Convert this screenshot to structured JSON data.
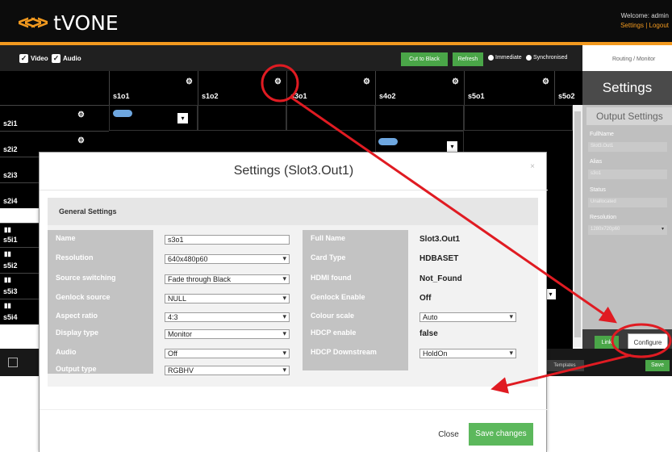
{
  "app": {
    "logo_text": "tVONE",
    "logo_mark": "<<>>"
  },
  "header": {
    "welcome": "Welcome: admin",
    "links": "Settings | Logout"
  },
  "toolbar": {
    "video_label": "Video",
    "audio_label": "Audio",
    "check_glyph": "✓",
    "cut_label": "Cut to Black",
    "refresh_label": "Refresh",
    "immediate_label": "Immediate",
    "synchronised_label": "Synchronised",
    "routing_label": "Routing / Monitor"
  },
  "grid": {
    "columns": [
      "s1o1",
      "s1o2",
      "s3o1",
      "s4o2",
      "s5o1",
      "s5o2"
    ],
    "rows": [
      "s2i1",
      "s2i2",
      "s2i3",
      "s2i4",
      "s5i1",
      "s5i2",
      "s5i3",
      "s5i4"
    ],
    "gear_glyph": "⚙",
    "dropdown_glyph": "▾"
  },
  "side_panel": {
    "title": "Settings",
    "subtitle": "Output Settings",
    "fields": [
      {
        "label": "FullName",
        "value": "Slot3.Out1"
      },
      {
        "label": "Alias",
        "value": "s3o1"
      },
      {
        "label": "Status",
        "value": "Unallocated"
      },
      {
        "label": "Resolution",
        "value": "1280x720p60"
      }
    ],
    "link_button": "Link",
    "configure_button": "Configure"
  },
  "bottom": {
    "templates_label": "Templates",
    "save_label": "Save"
  },
  "modal": {
    "title": "Settings (Slot3.Out1)",
    "close_x": "×",
    "section_title": "General Settings",
    "left_fields": [
      {
        "label": "Name",
        "value": "s3o1",
        "type": "text"
      },
      {
        "label": "Resolution",
        "value": "640x480p60",
        "type": "select"
      },
      {
        "label": "Source switching",
        "value": "Fade through Black",
        "type": "select"
      },
      {
        "label": "Genlock source",
        "value": "NULL",
        "type": "select"
      },
      {
        "label": "Aspect ratio",
        "value": "4:3",
        "type": "select"
      },
      {
        "label": "Display type",
        "value": "Monitor",
        "type": "select"
      },
      {
        "label": "Audio",
        "value": "Off",
        "type": "select"
      },
      {
        "label": "Output type",
        "value": "RGBHV",
        "type": "select"
      }
    ],
    "right_fields": [
      {
        "label": "Full Name",
        "value": "Slot3.Out1",
        "type": "text"
      },
      {
        "label": "Card Type",
        "value": "HDBASET",
        "type": "text"
      },
      {
        "label": "HDMI found",
        "value": "Not_Found",
        "type": "text"
      },
      {
        "label": "Genlock Enable",
        "value": "Off",
        "type": "text"
      },
      {
        "label": "Colour scale",
        "value": "Auto",
        "type": "select"
      },
      {
        "label": "HDCP enable",
        "value": "false",
        "type": "text"
      },
      {
        "label": "HDCP Downstream",
        "value": "HoldOn",
        "type": "select"
      }
    ],
    "close_button": "Close",
    "save_button": "Save changes"
  },
  "colors": {
    "accent_orange": "#f39a1f",
    "green": "#4aa648",
    "annotation_red": "#e01b22"
  }
}
